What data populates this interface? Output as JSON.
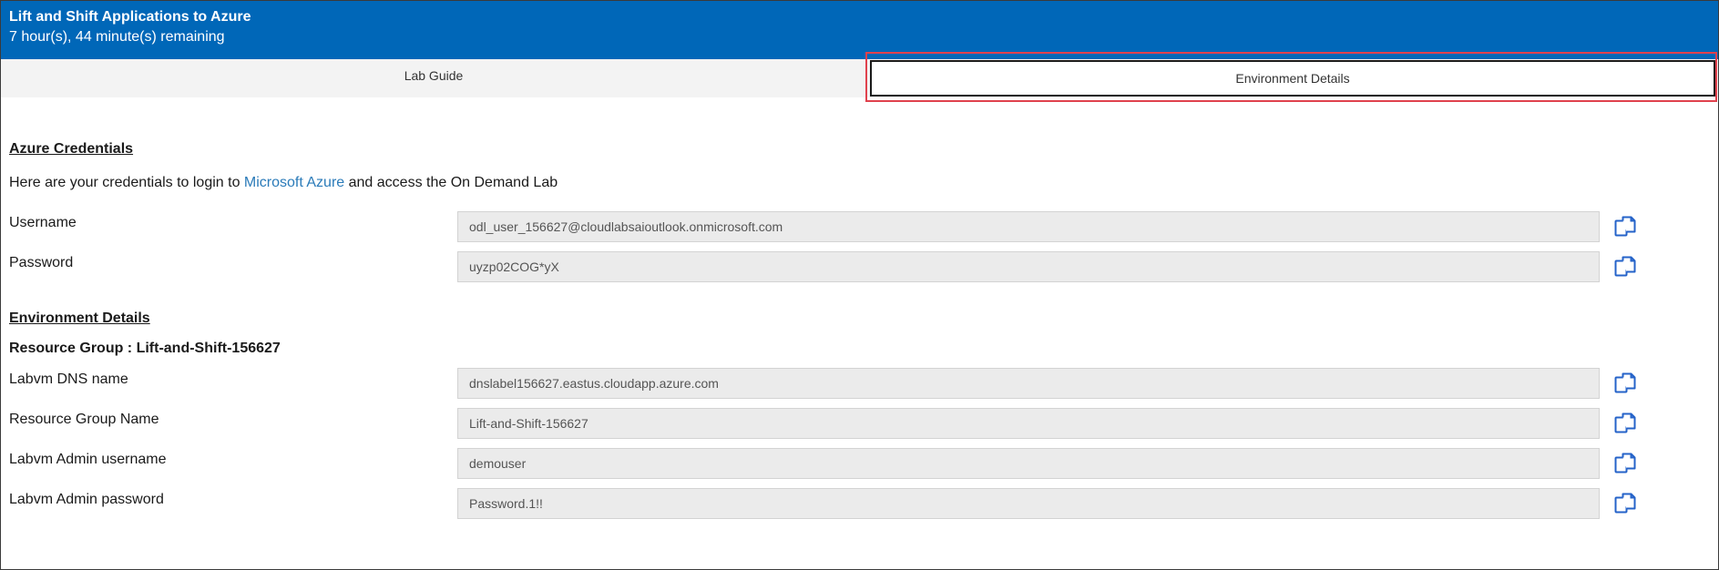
{
  "header": {
    "title": "Lift and Shift Applications to Azure",
    "timer": "7 hour(s), 44 minute(s) remaining"
  },
  "tabs": {
    "lab_guide": "Lab Guide",
    "environment_details": "Environment Details"
  },
  "credentials": {
    "heading": "Azure Credentials",
    "intro_before": "Here are your credentials to login to ",
    "intro_link": "Microsoft Azure",
    "intro_after": " and access the On Demand Lab",
    "username_label": "Username",
    "username_value": "odl_user_156627@cloudlabsaioutlook.onmicrosoft.com",
    "password_label": "Password",
    "password_value": "uyzp02COG*yX"
  },
  "environment": {
    "heading": "Environment Details",
    "resource_group_title": "Resource Group : Lift-and-Shift-156627",
    "rows": [
      {
        "label": "Labvm DNS name",
        "value": "dnslabel156627.eastus.cloudapp.azure.com"
      },
      {
        "label": "Resource Group Name",
        "value": "Lift-and-Shift-156627"
      },
      {
        "label": "Labvm Admin username",
        "value": "demouser"
      },
      {
        "label": "Labvm Admin password",
        "value": "Password.1!!"
      }
    ]
  },
  "colors": {
    "header_bg": "#0067b8",
    "link": "#2b7bb9",
    "highlight_outline": "#e0414d",
    "copy_icon": "#2563c9"
  },
  "icons": {
    "copy": "copy-icon"
  }
}
